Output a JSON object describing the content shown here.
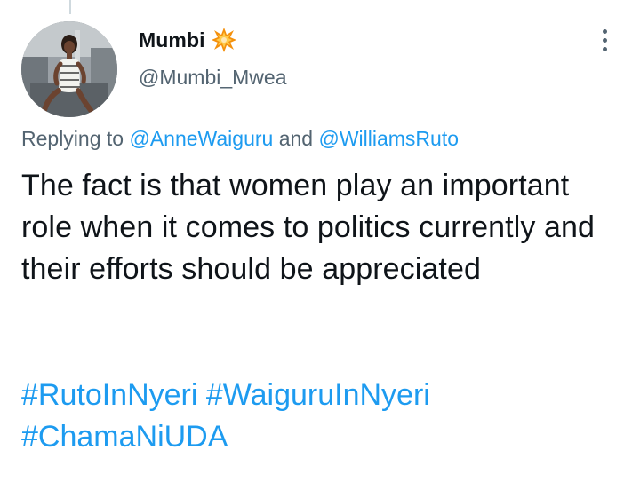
{
  "tweet": {
    "author": {
      "display_name": "Mumbi",
      "badge_icon": "collision-icon",
      "handle": "@Mumbi_Mwea",
      "avatar_icon": "profile-photo"
    },
    "more_icon": "three-dots-vertical-icon",
    "reply": {
      "prefix": "Replying to",
      "mention_1": "@AnneWaiguru",
      "conjunction": "and",
      "mention_2": "@WilliamsRuto"
    },
    "body": "The fact is that women play an important role when it comes to politics currently and their efforts should be appreciated",
    "hashtags": [
      "#RutoInNyeri",
      "#WaiguruInNyeri",
      "#ChamaNiUDA"
    ]
  },
  "colors": {
    "text": "#0f1419",
    "secondary": "#536471",
    "link": "#1d9bf0",
    "background": "#ffffff"
  }
}
